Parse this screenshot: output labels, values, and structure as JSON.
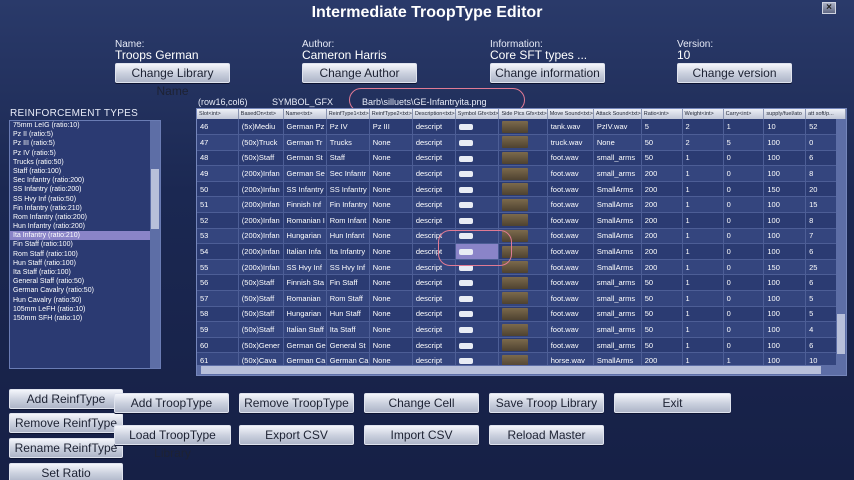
{
  "window": {
    "title": "Intermediate TroopType Editor",
    "close_glyph": "×"
  },
  "meta": {
    "name": {
      "label": "Name:",
      "value": "Troops German",
      "button": "Change Library Name"
    },
    "author": {
      "label": "Author:",
      "value": "Cameron Harris",
      "button": "Change Author"
    },
    "information": {
      "label": "Information:",
      "value": "Core SFT types ...",
      "button": "Change information"
    },
    "version": {
      "label": "Version:",
      "value": "10",
      "button": "Change version"
    }
  },
  "reinforcement": {
    "title": "REINFORCEMENT TYPES",
    "selected_index": 12,
    "items": [
      "75mm LeIG (ratio:10)",
      "Pz II (ratio:5)",
      "Pz III (ratio:5)",
      "Pz IV (ratio:5)",
      "Trucks (ratio:50)",
      "Staff (ratio:100)",
      "Sec Infantry (ratio:200)",
      "SS Infantry (ratio:200)",
      "SS Hvy Inf (ratio:50)",
      "Fin Infantry (ratio:210)",
      "Rom Infantry (ratio:200)",
      "Hun Infantry (ratio:200)",
      "Ita Infantry (ratio:210)",
      "Fin Staff (ratio:100)",
      "Rom Staff (ratio:100)",
      "Hun Staff (ratio:100)",
      "Ita Staff (ratio:100)",
      "General Staff (ratio:50)",
      "German Cavalry (ratio:50)",
      "Hun Cavalry (ratio:50)",
      "105mm LeFH (ratio:10)",
      "150mm SFH (ratio:10)"
    ]
  },
  "grid_info": {
    "cell": "(row16,col6)",
    "column": "SYMBOL_GFX",
    "path": "Barb\\silluets\\GE-Infantryita.png"
  },
  "grid": {
    "headers": [
      "Slot<int>",
      "BasedOn<txt>",
      "Name<txt>",
      "ReinfType1<txt>",
      "ReinfType2<txt>",
      "Description<txt>",
      "Symbol Gfx<txt>",
      "Side Pics Gfx<txt>",
      "Move Sound<txt>",
      "Attack Sound<txt>",
      "Ratio<int>",
      "Weight<int>",
      "Carry<int>",
      "supply/fuel/ato",
      "att soft/p..."
    ],
    "rows": [
      [
        "46",
        "(5x)Mediu",
        "German Pz",
        "Pz IV",
        "Pz III",
        "descript",
        "",
        "",
        "tank.wav",
        "PzIV.wav",
        "5",
        "2",
        "1",
        "10",
        "52"
      ],
      [
        "47",
        "(50x)Truck",
        "German Tr",
        "Trucks",
        "None",
        "descript",
        "",
        "",
        "truck.wav",
        "None",
        "50",
        "2",
        "5",
        "100",
        "0"
      ],
      [
        "48",
        "(50x)Staff",
        "German St",
        "Staff",
        "None",
        "descript",
        "",
        "",
        "foot.wav",
        "small_arms",
        "50",
        "1",
        "0",
        "100",
        "6"
      ],
      [
        "49",
        "(200x)Infan",
        "German Se",
        "Sec Infantr",
        "None",
        "descript",
        "",
        "",
        "foot.wav",
        "small_arms",
        "200",
        "1",
        "0",
        "100",
        "8"
      ],
      [
        "50",
        "(200x)Infan",
        "SS Infantry",
        "SS Infantry",
        "None",
        "descript",
        "",
        "",
        "foot.wav",
        "SmallArms",
        "200",
        "1",
        "0",
        "150",
        "20"
      ],
      [
        "51",
        "(200x)Infan",
        "Finnish Inf",
        "Fin Infantry",
        "None",
        "descript",
        "",
        "",
        "foot.wav",
        "SmallArms",
        "200",
        "1",
        "0",
        "100",
        "15"
      ],
      [
        "52",
        "(200x)Infan",
        "Romanian I",
        "Rom Infant",
        "None",
        "descript",
        "",
        "",
        "foot.wav",
        "SmallArms",
        "200",
        "1",
        "0",
        "100",
        "8"
      ],
      [
        "53",
        "(200x)Infan",
        "Hungarian",
        "Hun Infant",
        "None",
        "descript",
        "",
        "",
        "foot.wav",
        "SmallArms",
        "200",
        "1",
        "0",
        "100",
        "7"
      ],
      [
        "54",
        "(200x)Infan",
        "Italian Infa",
        "Ita Infantry",
        "None",
        "descript",
        "",
        "",
        "foot.wav",
        "SmallArms",
        "200",
        "1",
        "0",
        "100",
        "6"
      ],
      [
        "55",
        "(200x)Infan",
        "SS Hvy Inf",
        "SS Hvy Inf",
        "None",
        "descript",
        "",
        "",
        "foot.wav",
        "SmallArms",
        "200",
        "1",
        "0",
        "150",
        "25"
      ],
      [
        "56",
        "(50x)Staff",
        "Finnish Sta",
        "Fin Staff",
        "None",
        "descript",
        "",
        "",
        "foot.wav",
        "small_arms",
        "50",
        "1",
        "0",
        "100",
        "6"
      ],
      [
        "57",
        "(50x)Staff",
        "Romanian",
        "Rom Staff",
        "None",
        "descript",
        "",
        "",
        "foot.wav",
        "small_arms",
        "50",
        "1",
        "0",
        "100",
        "5"
      ],
      [
        "58",
        "(50x)Staff",
        "Hungarian",
        "Hun Staff",
        "None",
        "descript",
        "",
        "",
        "foot.wav",
        "small_arms",
        "50",
        "1",
        "0",
        "100",
        "5"
      ],
      [
        "59",
        "(50x)Staff",
        "Italian Staff",
        "Ita Staff",
        "None",
        "descript",
        "",
        "",
        "foot.wav",
        "small_arms",
        "50",
        "1",
        "0",
        "100",
        "4"
      ],
      [
        "60",
        "(50x)Gener",
        "German Ge",
        "General St",
        "None",
        "descript",
        "",
        "",
        "foot.wav",
        "small_arms",
        "50",
        "1",
        "0",
        "100",
        "6"
      ],
      [
        "61",
        "(50x)Cava",
        "German Ca",
        "German Ca",
        "None",
        "descript",
        "",
        "",
        "horse.wav",
        "SmallArms",
        "200",
        "1",
        "1",
        "100",
        "10"
      ]
    ],
    "selected_row": 8,
    "selected_col": 6
  },
  "buttons": {
    "add_reinf": "Add ReinfType",
    "remove_reinf": "Remove ReinfType",
    "rename_reinf": "Rename ReinfType",
    "set_ratio": "Set Ratio",
    "add_troop": "Add TroopType",
    "load_library": "Load TroopType Library",
    "remove_troop": "Remove TroopType",
    "export_csv": "Export CSV",
    "change_cell": "Change Cell",
    "import_csv": "Import CSV",
    "save_library": "Save Troop Library",
    "reload_master": "Reload Master",
    "exit": "Exit"
  }
}
